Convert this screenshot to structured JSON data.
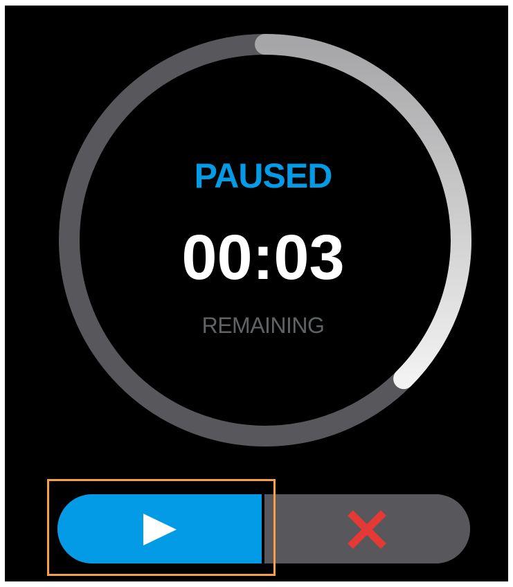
{
  "timer": {
    "status": "PAUSED",
    "time": "00:03",
    "caption": "REMAINING",
    "progress_elapsed_fraction": 0.625
  },
  "controls": {
    "play_icon": "play-icon",
    "stop_icon": "close-icon"
  },
  "colors": {
    "status_text": "#039be5",
    "caption_text": "#5f6366",
    "ring_track": "#58585c",
    "ring_progress_start": "#e6e6e6",
    "ring_progress_end": "#a6a6a8",
    "play_button": "#039be5",
    "stop_button": "#58585c",
    "stop_icon": "#e53935",
    "focus_outline": "#f7a046"
  }
}
